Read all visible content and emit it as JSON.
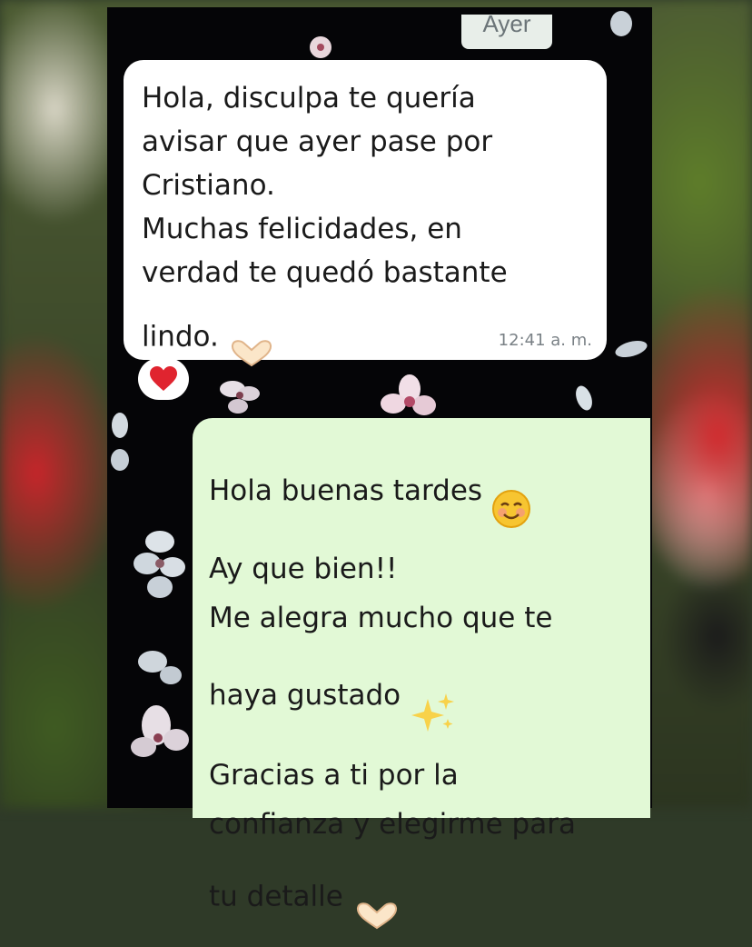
{
  "date_chip": "Ayer",
  "incoming": {
    "text": "Hola, disculpa te quería\navisar que ayer pase por\nCristiano.\nMuchas felicidades, en\nverdad te quedó bastante\nlindo.",
    "time": "12:41 a. m.",
    "reaction_icon": "heart-emoji-icon"
  },
  "outgoing": {
    "lines": [
      "Hola buenas tardes",
      "Ay que bien!!",
      "Me alegra mucho que te",
      "haya gustado",
      "Gracias a ti por la",
      "confianza y elegirme para",
      "tu detalle"
    ]
  },
  "colors": {
    "incoming_bubble": "#ffffff",
    "outgoing_bubble": "#e2f9d6",
    "chat_background": "#050507",
    "reaction_heart": "#e0242f"
  }
}
